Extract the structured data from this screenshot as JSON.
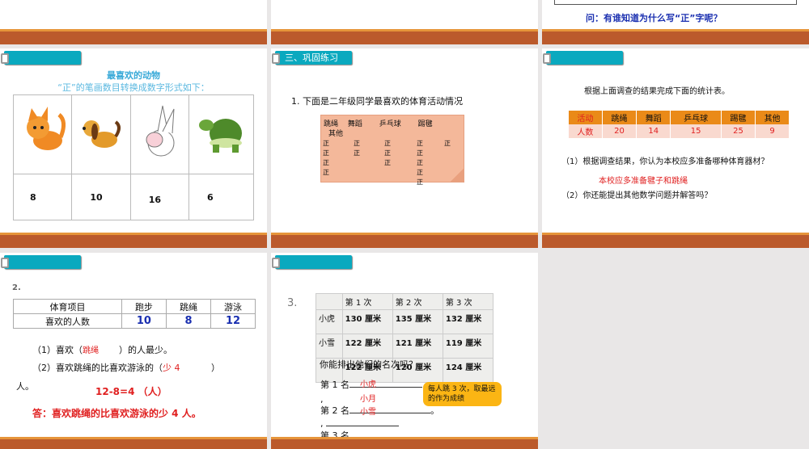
{
  "slide_top_right": {
    "question": "问：有谁知道为什么写“正”字呢？"
  },
  "slide_animals": {
    "tag": "",
    "title": "最喜欢的动物",
    "subtitle": "“正”的笔画数目转换成数字形式如下：",
    "animals": [
      {
        "icon": "cat-icon",
        "value": "8"
      },
      {
        "icon": "dog-icon",
        "value": "10"
      },
      {
        "icon": "rabbit-icon",
        "value": "16"
      },
      {
        "icon": "turtle-icon",
        "value": "6"
      }
    ]
  },
  "slide_practice": {
    "tag": "三、巩固练习",
    "question": "1. 下面是二年级同学最喜欢的体育活动情况",
    "headers": "跳绳　 舞蹈　　 乒乓球　　 踢毽",
    "header2": "其他",
    "tallies": [
      [
        "正",
        "正",
        "正",
        "正",
        "正"
      ],
      [
        "正",
        "正",
        "正",
        "正",
        ""
      ],
      [
        "正",
        "",
        "正",
        "正",
        ""
      ],
      [
        "正",
        "",
        "",
        "正",
        ""
      ],
      [
        "",
        "",
        "",
        "正",
        ""
      ]
    ]
  },
  "slide_stats": {
    "tag": "",
    "intro": "根据上面调查的结果完成下面的统计表。",
    "header": [
      "活动",
      "跳绳",
      "舞蹈",
      "乒乓球",
      "踢毽",
      "其他"
    ],
    "row": [
      "人数",
      "20",
      "14",
      "15",
      "25",
      "9"
    ],
    "q1": "（1）根据调查结果，你认为本校应多准备哪种体育器材？",
    "a1": "本校应多准备毽子和跳绳",
    "q2": "（2）你还能提出其他数学问题并解答吗？"
  },
  "slide_q2": {
    "tag": "",
    "num": "2.",
    "header": [
      "体育项目",
      "跑步",
      "跳绳",
      "游泳"
    ],
    "row": [
      "喜欢的人数",
      "10",
      "8",
      "12"
    ],
    "q1a": "（1）喜欢（",
    "q1ans": "跳绳",
    "q1b": "）的人最少。",
    "q2a": "（2）喜欢跳绳的比喜欢游泳的（",
    "q2ans": "少 4",
    "q2b": "）",
    "q2c": "人。",
    "calc": "12-8=4 （人）",
    "answer": "答：喜欢跳绳的比喜欢游泳的少 4 人。"
  },
  "slide_q3": {
    "tag": "",
    "num": "3.",
    "header": [
      "",
      "第 1 次",
      "第 2 次",
      "第 3 次"
    ],
    "rows": [
      [
        "小虎",
        "130 厘米",
        "135 厘米",
        "132 厘米"
      ],
      [
        "小雪",
        "122 厘米",
        "121 厘米",
        "119 厘米"
      ],
      [
        "",
        "122 厘米",
        "120 厘米",
        "124 厘米"
      ]
    ],
    "question": "你能排出他们的名次吗？",
    "rank1": "第 1 名",
    "rank2": "第 2 名",
    "rank3": "第 3 名",
    "ans1": "小虎",
    "ans2": "小月",
    "ans3": "小雪",
    "callout": "每人跳 3 次，取最远的作为成绩"
  }
}
